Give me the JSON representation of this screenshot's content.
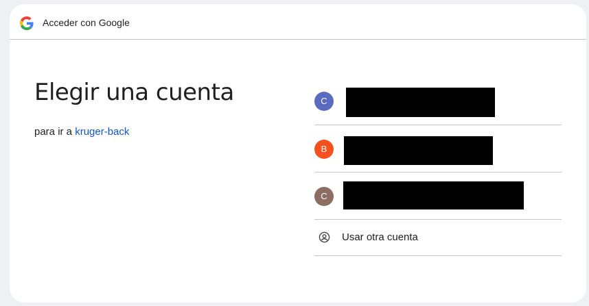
{
  "header": {
    "title": "Acceder con Google"
  },
  "main": {
    "title": "Elegir una cuenta",
    "subtitle_prefix": "para ir a",
    "app_name": "kruger-back"
  },
  "accounts": [
    {
      "initial": "C",
      "color": "#5c6bc0"
    },
    {
      "initial": "B",
      "color": "#f4511e"
    },
    {
      "initial": "C",
      "color": "#8d6e63"
    }
  ],
  "other_account": {
    "label": "Usar otra cuenta",
    "icon": "account-circle-icon"
  },
  "colors": {
    "link": "#0b57d0",
    "divider": "#c4c7c5",
    "background": "#eef0f4"
  }
}
